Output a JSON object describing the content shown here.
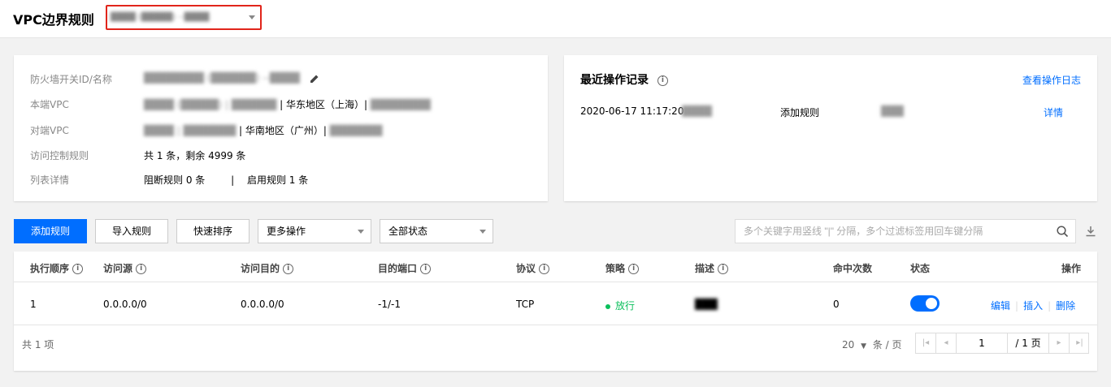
{
  "header": {
    "title": "VPC边界规则",
    "instance_select_value": "████ (█████) --████"
  },
  "info": {
    "gateway_label": "防火墙开关ID/名称",
    "gateway_value": "████████ (██████) --████",
    "local_vpc_label": "本端VPC",
    "local_vpc_name": "████ (█████) | ██████",
    "local_vpc_region": "| 华东地区（上海）|",
    "local_vpc_cidr": "████████",
    "peer_vpc_label": "对端VPC",
    "peer_vpc_name": "████ | ███████",
    "peer_vpc_region": "| 华南地区（广州）|",
    "peer_vpc_cidr": "███████",
    "acl_label": "访问控制规则",
    "acl_value": "共 1 条，剩余 4999 条",
    "detail_label": "列表详情",
    "detail_block": "阻断规则 0 条",
    "detail_sep": "|",
    "detail_enabled": "启用规则 1 条"
  },
  "log": {
    "title": "最近操作记录",
    "view_log_link": "查看操作日志",
    "entries": [
      {
        "time": "2020-06-17 11:17:20",
        "user": "████",
        "action": "添加规则",
        "target": "███",
        "detail_link": "详情"
      }
    ]
  },
  "toolbar": {
    "add_rule": "添加规则",
    "import_rule": "导入规则",
    "quick_sort": "快速排序",
    "more_ops": "更多操作",
    "status_filter": "全部状态",
    "search_placeholder": "多个关键字用竖线 \"|\" 分隔，多个过滤标签用回车键分隔"
  },
  "table": {
    "headers": [
      "执行顺序",
      "访问源",
      "访问目的",
      "目的端口",
      "协议",
      "策略",
      "描述",
      "命中次数",
      "状态",
      "操作"
    ],
    "rows": [
      {
        "order": "1",
        "source": "0.0.0.0/0",
        "dest": "0.0.0.0/0",
        "port": "-1/-1",
        "protocol": "TCP",
        "policy": "放行",
        "desc": "███",
        "hits": "0",
        "enabled": true,
        "edit": "编辑",
        "insert": "插入",
        "delete": "删除"
      }
    ],
    "footer_total": "共 1 项",
    "page_size": "20",
    "page_size_unit": "条 / 页",
    "current_page": "1",
    "total_pages": "/ 1 页"
  },
  "colors": {
    "accent": "#006eff",
    "success": "#0abf5b",
    "highlight_border": "#e1251b"
  }
}
